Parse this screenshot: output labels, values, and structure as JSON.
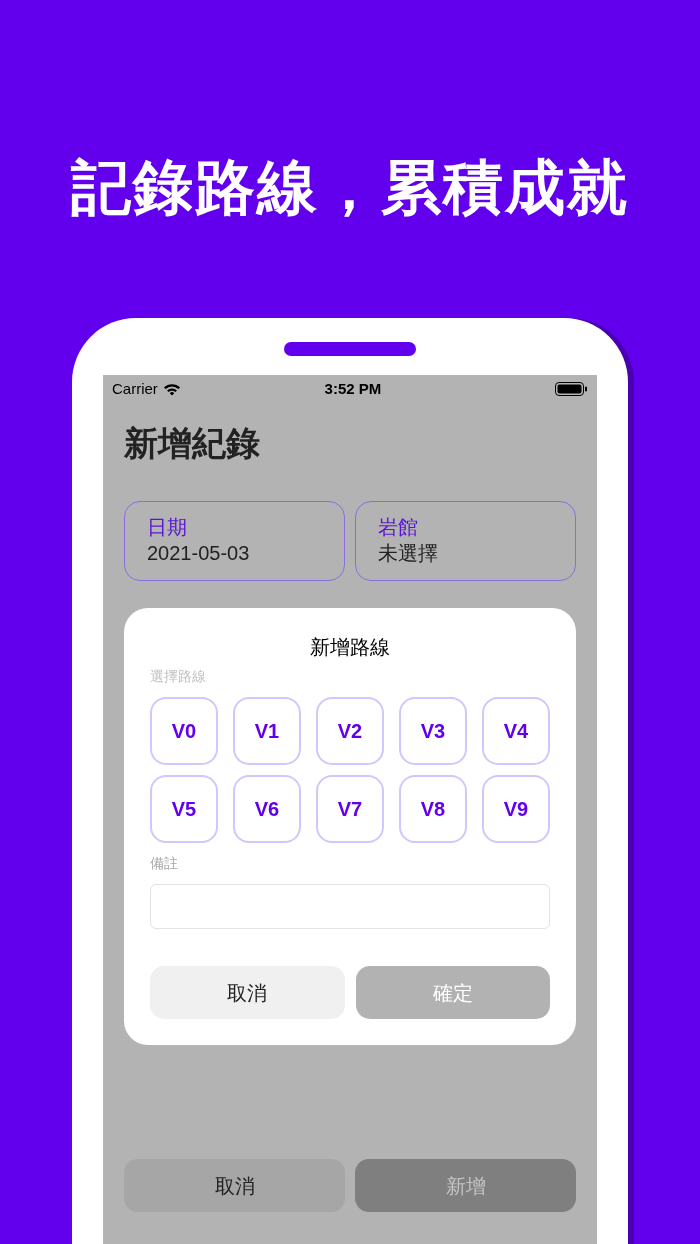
{
  "headline": "記錄路線，累積成就",
  "status_bar": {
    "carrier": "Carrier",
    "time": "3:52 PM"
  },
  "page_title": "新增紀錄",
  "fields": [
    {
      "label": "日期",
      "value": "2021-05-03"
    },
    {
      "label": "岩館",
      "value": "未選擇"
    }
  ],
  "footer_buttons": [
    {
      "label": "取消",
      "disabled": false
    },
    {
      "label": "新增",
      "disabled": true
    }
  ],
  "dialog": {
    "title": "新增路線",
    "grade_label": "選擇路線",
    "grades": [
      {
        "label": "V0",
        "selected": false
      },
      {
        "label": "V1",
        "selected": false
      },
      {
        "label": "V2",
        "selected": false
      },
      {
        "label": "V3",
        "selected": false
      },
      {
        "label": "V4",
        "selected": false
      },
      {
        "label": "V5",
        "selected": false
      },
      {
        "label": "V6",
        "selected": false
      },
      {
        "label": "V7",
        "selected": false
      },
      {
        "label": "V8",
        "selected": false
      },
      {
        "label": "V9",
        "selected": false
      }
    ],
    "note_label": "備註",
    "buttons": [
      {
        "label": "取消",
        "disabled": false
      },
      {
        "label": "確定",
        "disabled": true
      }
    ]
  }
}
